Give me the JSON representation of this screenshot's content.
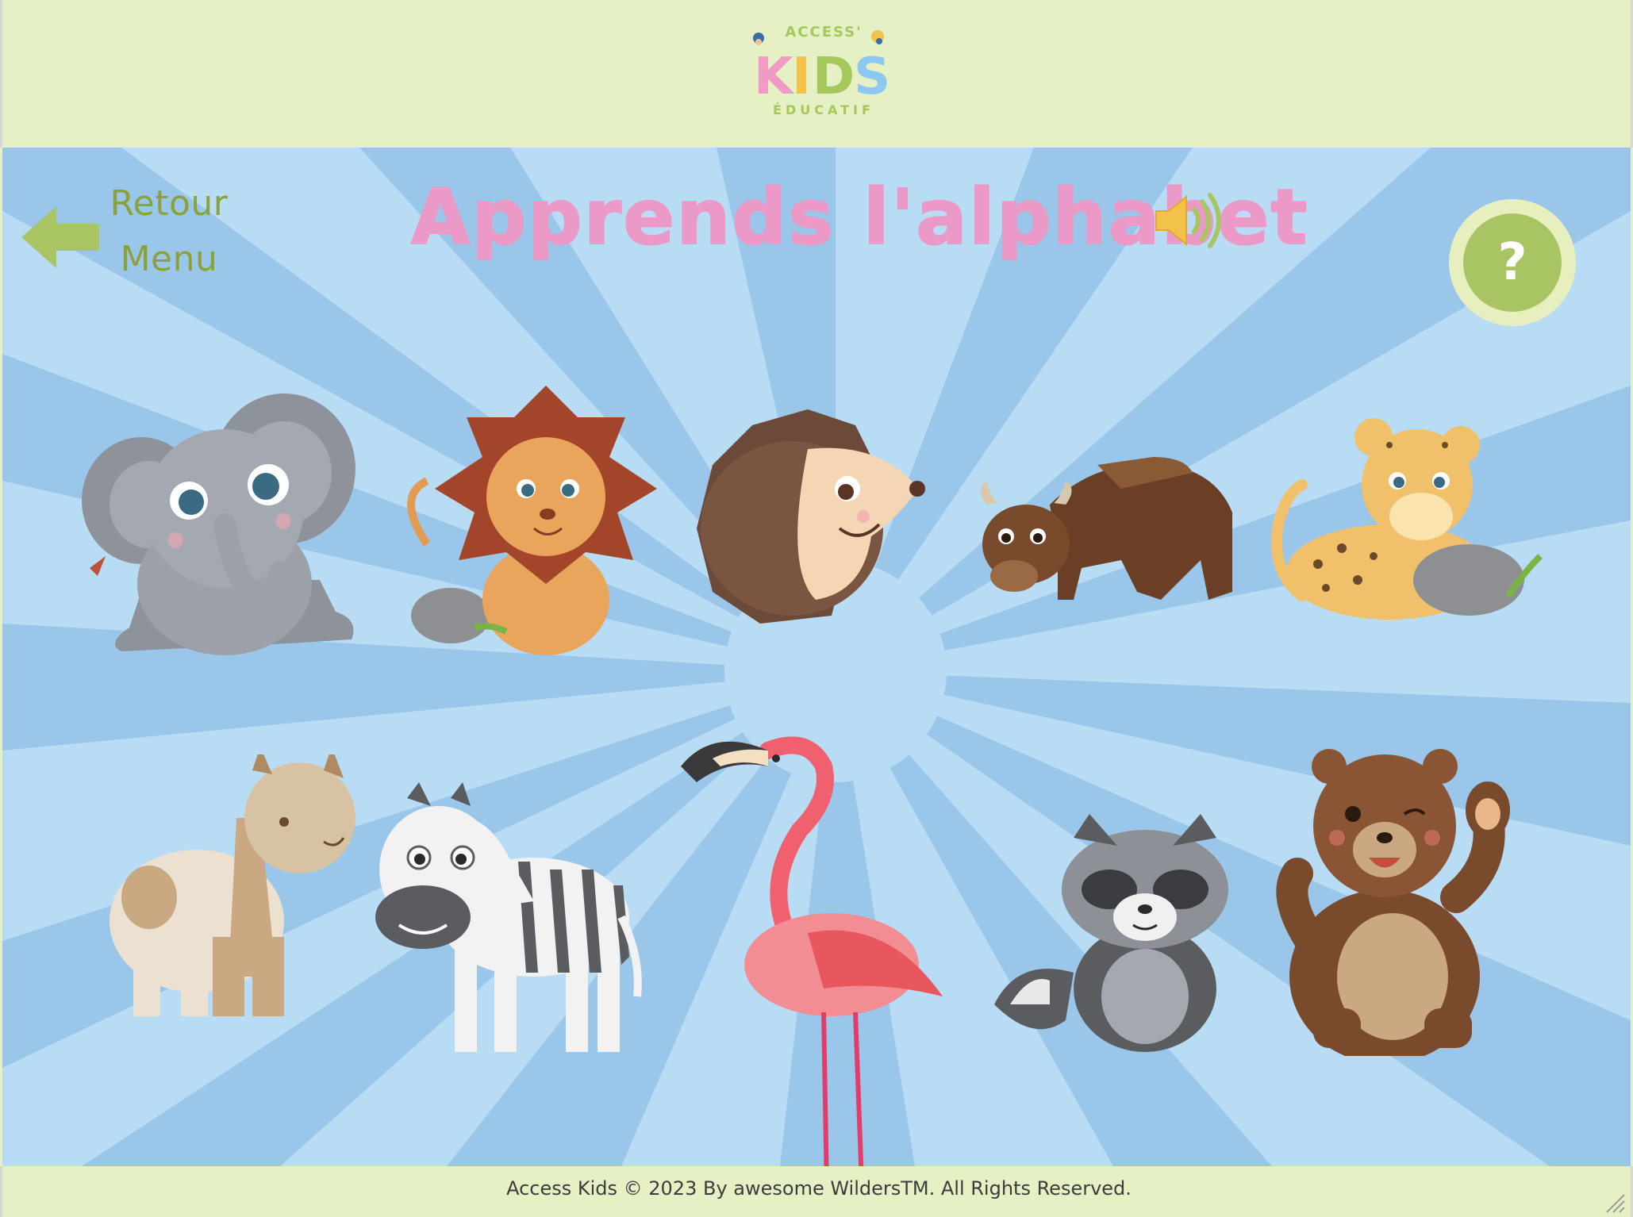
{
  "header": {
    "logo": {
      "top": "ACCESS'",
      "main": "KIDS",
      "bottom": "ÉDUCATIF"
    }
  },
  "nav": {
    "back_label": "Retour\nMenu"
  },
  "title": "Apprends l'alphabet",
  "icons": {
    "back": "left-arrow-icon",
    "sound": "speaker-icon",
    "help": "question-icon"
  },
  "help_label": "?",
  "animals": [
    {
      "name": "elephant"
    },
    {
      "name": "lion"
    },
    {
      "name": "hedgehog"
    },
    {
      "name": "yak"
    },
    {
      "name": "leopard"
    },
    {
      "name": "alpaca"
    },
    {
      "name": "zebra"
    },
    {
      "name": "flamingo"
    },
    {
      "name": "raccoon"
    },
    {
      "name": "bear"
    }
  ],
  "footer": {
    "copyright": "Access Kids © 2023 By awesome WildersTM. All Rights Reserved."
  },
  "colors": {
    "header_bg": "#e5f0c4",
    "stage_bg": "#b9dcf5",
    "ray": "#9cc8ea",
    "title": "#eb9ac7",
    "accent_green": "#a9c563",
    "logo_pink": "#f09ac6",
    "logo_green": "#a5c85a",
    "logo_blue": "#8cc8ef"
  }
}
